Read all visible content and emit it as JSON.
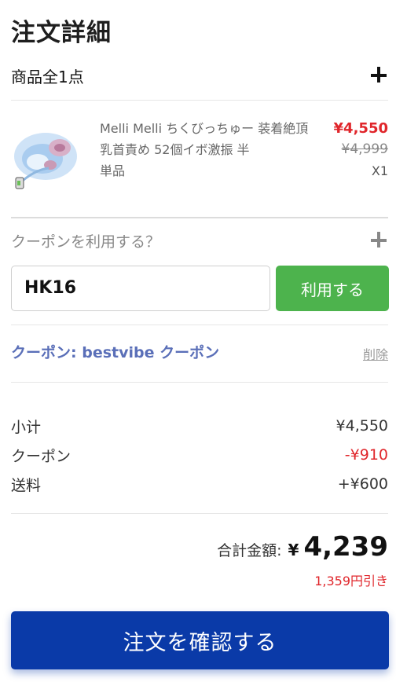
{
  "header": {
    "title": "注文詳細"
  },
  "items": {
    "count_label": "商品全1点",
    "toggle_icon": "plus-icon"
  },
  "product": {
    "name": "Melli Melli ちくびっちゅー 装着絶頂 乳首責め 52個イボ激振 半",
    "variant": "単品",
    "sale_price": "¥4,550",
    "original_price": "¥4,999",
    "quantity": "X1"
  },
  "coupon": {
    "question": "クーポンを利用する？",
    "toggle_icon": "plus-icon",
    "input_value": "HK16",
    "apply_label": "利用する",
    "applied_label": "クーポン: bestvibe クーポン",
    "remove_label": "削除"
  },
  "summary": {
    "subtotal_label": "小计",
    "subtotal_value": "¥4,550",
    "coupon_label": "クーポン",
    "coupon_value": "-¥910",
    "shipping_label": "送料",
    "shipping_value": "+¥600",
    "total_label": "合計金額:",
    "total_currency": "¥",
    "total_value": "4,239",
    "discount_note": "1,359円引き"
  },
  "actions": {
    "confirm_label": "注文を確認する"
  },
  "colors": {
    "accent_red": "#e0262b",
    "apply_green": "#4db34d",
    "confirm_blue": "#0a3aa8",
    "coupon_blue": "#5a6fb8"
  }
}
